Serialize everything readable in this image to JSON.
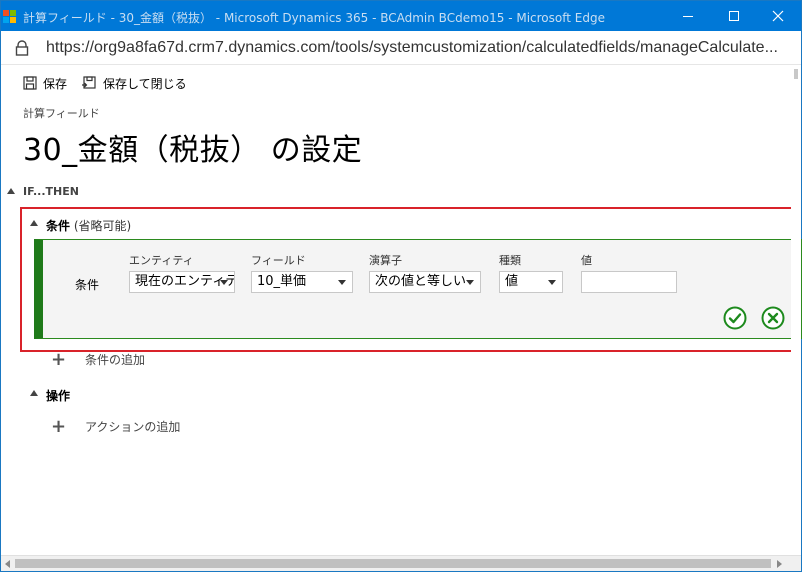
{
  "window": {
    "title": "計算フィールド - 30_金額（税抜） - Microsoft Dynamics 365 - BCAdmin BCdemo15 - Microsoft Edge",
    "minimize_icon": "minimize-icon",
    "maximize_icon": "maximize-icon",
    "close_icon": "close-icon"
  },
  "address": {
    "url": "https://org9a8fa67d.crm7.dynamics.com/tools/systemcustomization/calculatedfields/manageCalculate..."
  },
  "toolbar": {
    "save_label": "保存",
    "save_close_label": "保存して閉じる"
  },
  "page": {
    "subtitle": "計算フィールド",
    "title": "30_金額（税抜） の設定"
  },
  "if_then": {
    "label": "IF...THEN"
  },
  "conditions": {
    "header": "条件",
    "optional_note": "(省略可能)",
    "row_label": "条件",
    "columns": {
      "entity": "エンティティ",
      "field": "フィールド",
      "operator": "演算子",
      "type": "種類",
      "value": "値"
    },
    "selected": {
      "entity": "現在のエンティティ",
      "field": "10_単価",
      "operator": "次の値と等しい",
      "type": "値",
      "value": ""
    },
    "add_label": "条件の追加"
  },
  "actions": {
    "header": "操作",
    "add_label": "アクションの追加"
  },
  "colors": {
    "titlebar": "#0078d7",
    "highlight": "#d9232a",
    "condition_bar": "#1f7a1a",
    "confirm": "#1d8a1d"
  }
}
